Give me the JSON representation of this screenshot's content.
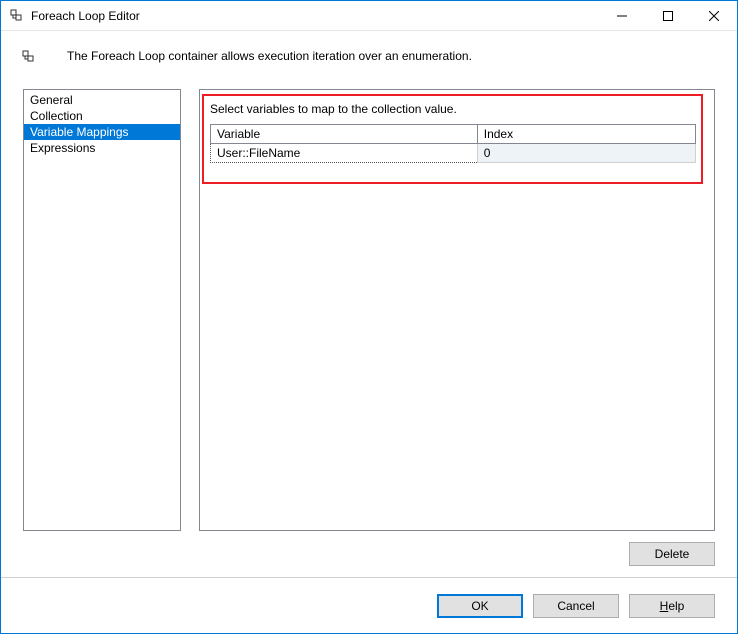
{
  "window": {
    "title": "Foreach Loop Editor"
  },
  "description": "The Foreach Loop container allows execution iteration over an enumeration.",
  "sidebar": {
    "items": [
      {
        "label": "General"
      },
      {
        "label": "Collection"
      },
      {
        "label": "Variable Mappings"
      },
      {
        "label": "Expressions"
      }
    ],
    "selected_index": 2
  },
  "content": {
    "instruction": "Select variables to map to the collection value.",
    "columns": {
      "variable": "Variable",
      "index": "Index"
    },
    "rows": [
      {
        "variable": "User::FileName",
        "index": "0"
      }
    ]
  },
  "buttons": {
    "delete": "Delete",
    "ok": "OK",
    "cancel": "Cancel",
    "help_prefix": "H",
    "help_rest": "elp"
  },
  "colors": {
    "accent": "#0078d7",
    "highlight": "#ee1c25"
  }
}
